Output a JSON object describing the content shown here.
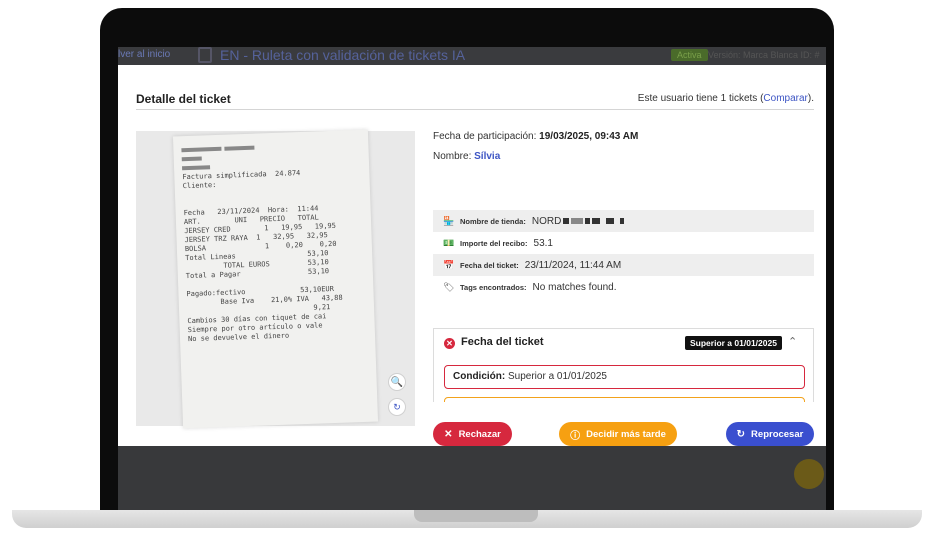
{
  "background_app": {
    "back_link": "lver al inicio",
    "title": "EN - Ruleta con validación de tickets IA",
    "status_badge": "Activa",
    "version": "Versión: Marca Blanca   ID: #"
  },
  "modal": {
    "title": "Detalle del ticket",
    "users_text": "Este usuario tiene 1 tickets (",
    "compare_link": "Comparar",
    "users_text_end": ")."
  },
  "participation": {
    "date_label": "Fecha de participación: ",
    "date_value": "19/03/2025, 09:43 AM",
    "name_label": "Nombre: ",
    "name_value": "Sílvia"
  },
  "fields": [
    {
      "icon": "store-icon",
      "label": "Nombre de tienda:",
      "value": "NORD"
    },
    {
      "icon": "money-icon",
      "label": "Importe del recibo:",
      "value": "53.1"
    },
    {
      "icon": "calendar-icon",
      "label": "Fecha del ticket:",
      "value": "23/11/2024, 11:44 AM"
    },
    {
      "icon": "tag-icon",
      "label": "Tags encontrados:",
      "value": "No matches found."
    }
  ],
  "validation": {
    "title": "Fecha del ticket",
    "badge": "Superior a 01/01/2025",
    "condition_label": "Condición:",
    "condition_value": " Superior a 01/01/2025"
  },
  "receipt_lines": [
    "Factura simplificada  24.874",
    "Cliente:",
    "Fecha   23/11/2024  Hora:  11:44",
    "ART.        UNI   PRECIO   TOTAL",
    "JERSEY CRED        1   19,95   19,95",
    "JERSEY TRZ RAYA  1   32,95   32,95",
    "BOLSA              1    0,20    0,20",
    "Total Lineas                 53,10",
    "         TOTAL EUROS         53,10",
    "Total a Pagar                53,10",
    "Pagado:fectivo             53,10EUR",
    "        Base Iva    21,0% IVA   43,88",
    "                              9,21",
    "Cambios 30 días con tiquet de cai",
    "Siempre por otro artículo o vale",
    "No se devuelve el dinero"
  ],
  "actions": {
    "reject": "Rechazar",
    "later": "Decidir más tarde",
    "reprocess": "Reprocesar"
  },
  "colors": {
    "reject": "#d6283e",
    "later": "#f6a011",
    "reprocess": "#3a4fcf",
    "link": "#3d55c4"
  }
}
